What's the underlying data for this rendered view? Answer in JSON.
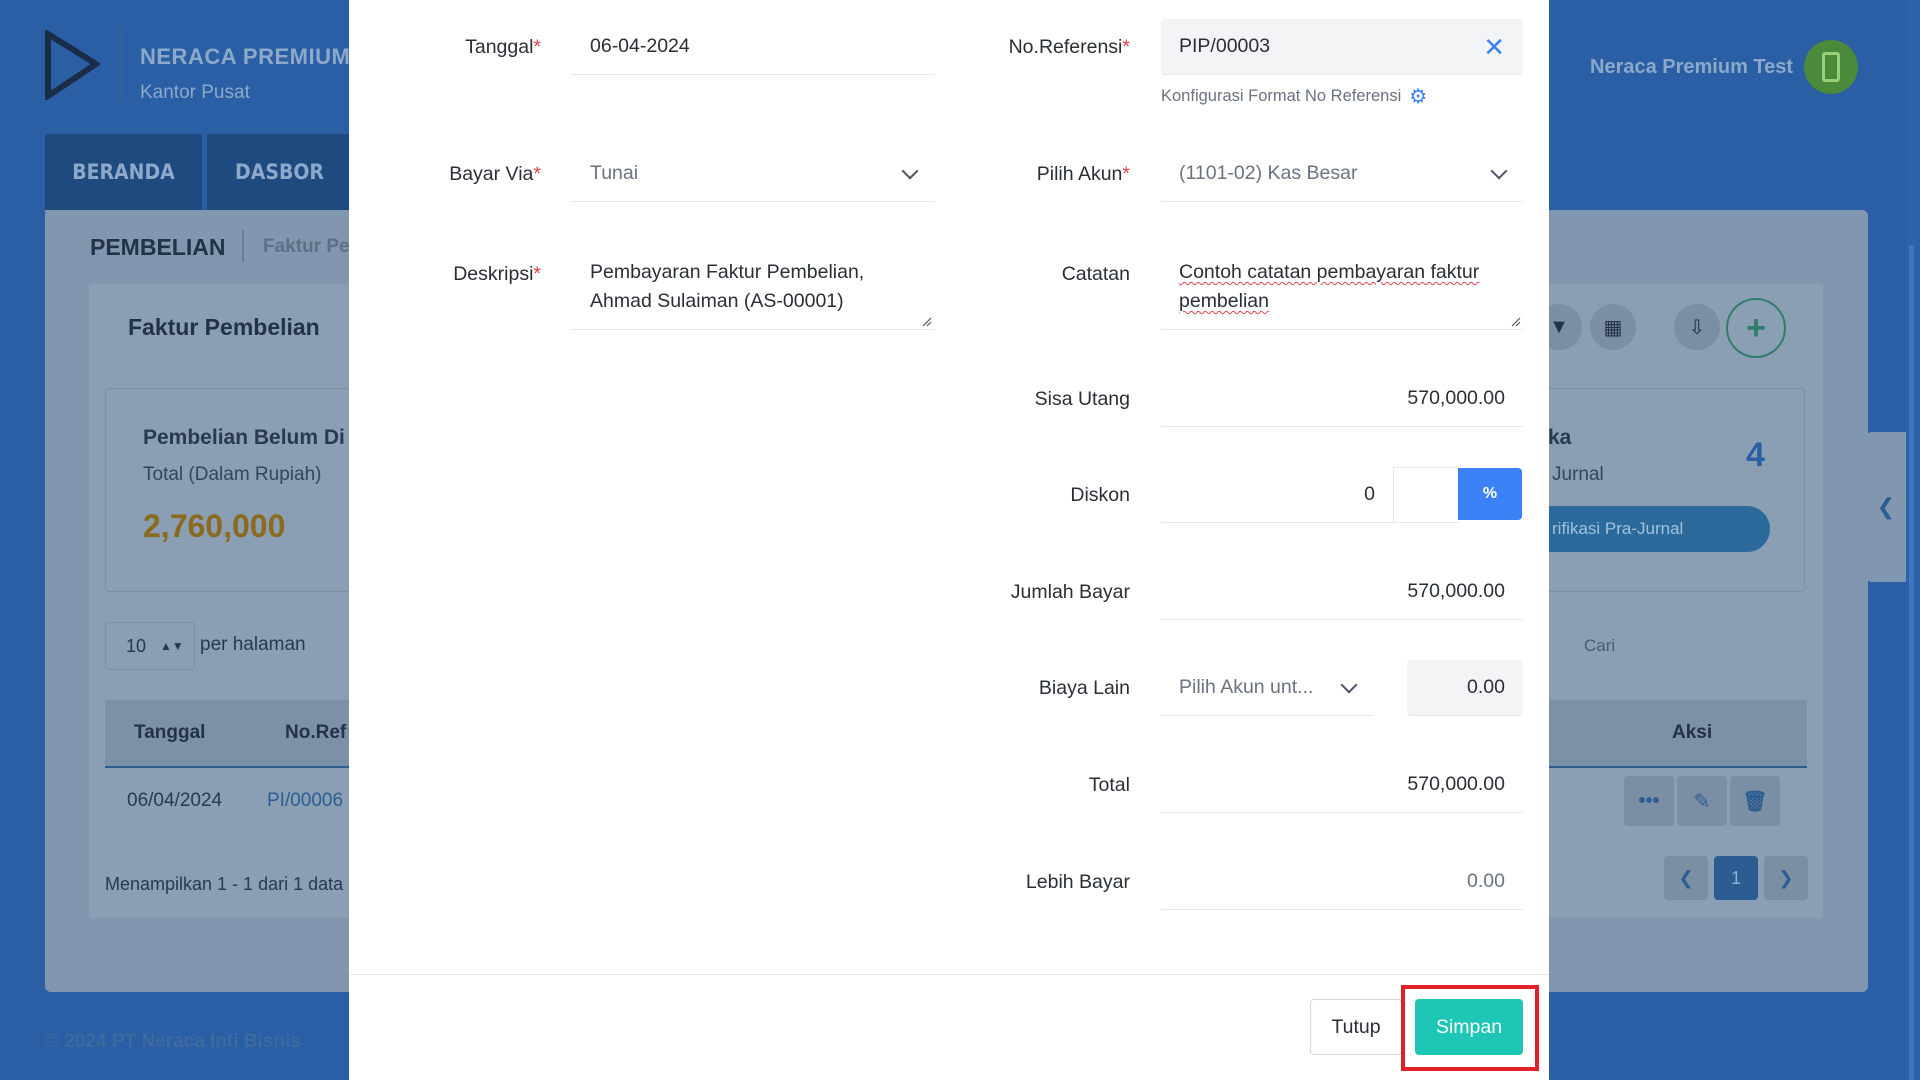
{
  "background_app": {
    "brand_name": "NERACA PREMIUM",
    "brand_sub": "Kantor Pusat",
    "user_name": "Neraca Premium Test",
    "nav": [
      "BERANDA",
      "DASBOR"
    ],
    "breadcrumb_title": "PEMBELIAN",
    "breadcrumb_sub": "Faktur Pe",
    "card_title": "Faktur Pembelian",
    "stat_left_label": "Pembelian Belum Di",
    "stat_left_sub": "Total (Dalam Rupiah)",
    "stat_left_value": "2,760,000",
    "stat_right_label": "ka",
    "stat_right_sub": "Jurnal",
    "stat_right_count": "4",
    "stat_right_button": "rifikasi Pra-Jurnal",
    "per_page_value": "10",
    "per_page_label": "per halaman",
    "search_placeholder": "Cari",
    "table_headers": [
      "Tanggal",
      "No.Ref",
      "Aksi"
    ],
    "table_row": {
      "date": "06/04/2024",
      "ref": "PI/00006"
    },
    "footer_text": "Menampilkan 1 - 1 dari 1 data",
    "page_current": "1",
    "copyright": "© 2024 PT Neraca Inti Bisnis"
  },
  "modal": {
    "tanggal": {
      "label": "Tanggal",
      "value": "06-04-2024"
    },
    "no_referensi": {
      "label": "No.Referensi",
      "value": "PIP/00003",
      "config_link": "Konfigurasi Format No Referensi"
    },
    "bayar_via": {
      "label": "Bayar Via",
      "value": "Tunai"
    },
    "pilih_akun": {
      "label": "Pilih Akun",
      "value": "(1101-02) Kas Besar"
    },
    "deskripsi": {
      "label": "Deskripsi",
      "value_line1": "Pembayaran Faktur Pembelian,",
      "value_line2": "Ahmad Sulaiman (AS-00001)"
    },
    "catatan": {
      "label": "Catatan",
      "value_line1": "Contoh catatan pembayaran faktur",
      "value_line2": "pembelian"
    },
    "sisa_utang": {
      "label": "Sisa Utang",
      "value": "570,000.00"
    },
    "diskon": {
      "label": "Diskon",
      "value": "0",
      "unit": "%"
    },
    "jumlah_bayar": {
      "label": "Jumlah Bayar",
      "value": "570,000.00"
    },
    "biaya_lain": {
      "label": "Biaya Lain",
      "account_placeholder": "Pilih Akun unt...",
      "value": "0.00"
    },
    "total": {
      "label": "Total",
      "value": "570,000.00"
    },
    "lebih_bayar": {
      "label": "Lebih Bayar",
      "value": "0.00"
    },
    "required_mark": "*",
    "buttons": {
      "close": "Tutup",
      "save": "Simpan"
    }
  },
  "colors": {
    "primary_bg": "#2a5ea5",
    "accent_blue": "#3b82f6",
    "save_button": "#1ec7b5",
    "highlight": "#e0202a",
    "required": "#e0454d"
  }
}
